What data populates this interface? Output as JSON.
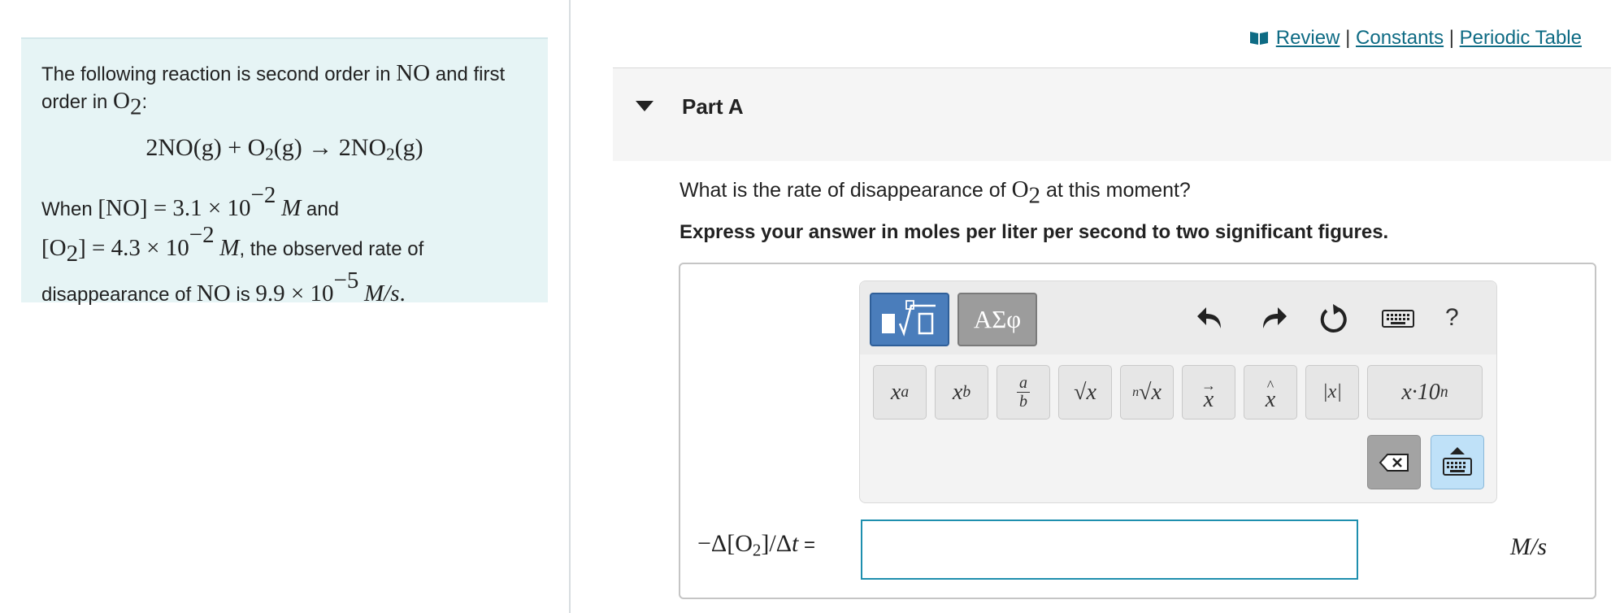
{
  "problem": {
    "intro_1": "The following reaction is second order in ",
    "no": "NO",
    "intro_2": " and first order in ",
    "o": "O",
    "two": "2",
    "colon": ":",
    "eq_left": "2NO(g) + O",
    "eq_mid": "(g) → 2NO",
    "eq_right": "(g)",
    "when": "When ",
    "no_conc": "[NO] = 3.1 × 10",
    "exp": "−2",
    "M": "M",
    "and": " and",
    "o2_open": "[O",
    "o2_close": "] = 4.3 × 10",
    "comma_text": ", the observed rate of",
    "disappearance": "disappearance of ",
    "is": " is ",
    "rate": "9.9 × 10",
    "rate_exp": "−5",
    "rate_unit": "M/s",
    "period": "."
  },
  "links": {
    "review": "Review",
    "sep": " | ",
    "constants": "Constants",
    "periodic_table": "Periodic Table"
  },
  "part": {
    "title": "Part A"
  },
  "question": {
    "text_1": "What is the rate of disappearance of ",
    "o": "O",
    "two": "2",
    "text_2": " at this moment?",
    "instruction": "Express your answer in moles per liter per second to two significant figures."
  },
  "editor": {
    "symbols_label": "ΑΣφ",
    "help": "?",
    "keys": [
      "x",
      "a",
      "x",
      "b",
      "a",
      "b",
      "√x",
      "n",
      "√x",
      "x",
      "x",
      "|x|",
      "x·10",
      "n"
    ]
  },
  "answer": {
    "label_1": "−Δ[O",
    "label_two": "2",
    "label_2": "]/Δ",
    "label_t": "t",
    "label_eq": " =",
    "value": "",
    "units": "M/s"
  },
  "colors": {
    "accent": "#4a7dbb",
    "link": "#0e6b84",
    "panel": "#e6f4f5",
    "input_border": "#1e8fae"
  }
}
